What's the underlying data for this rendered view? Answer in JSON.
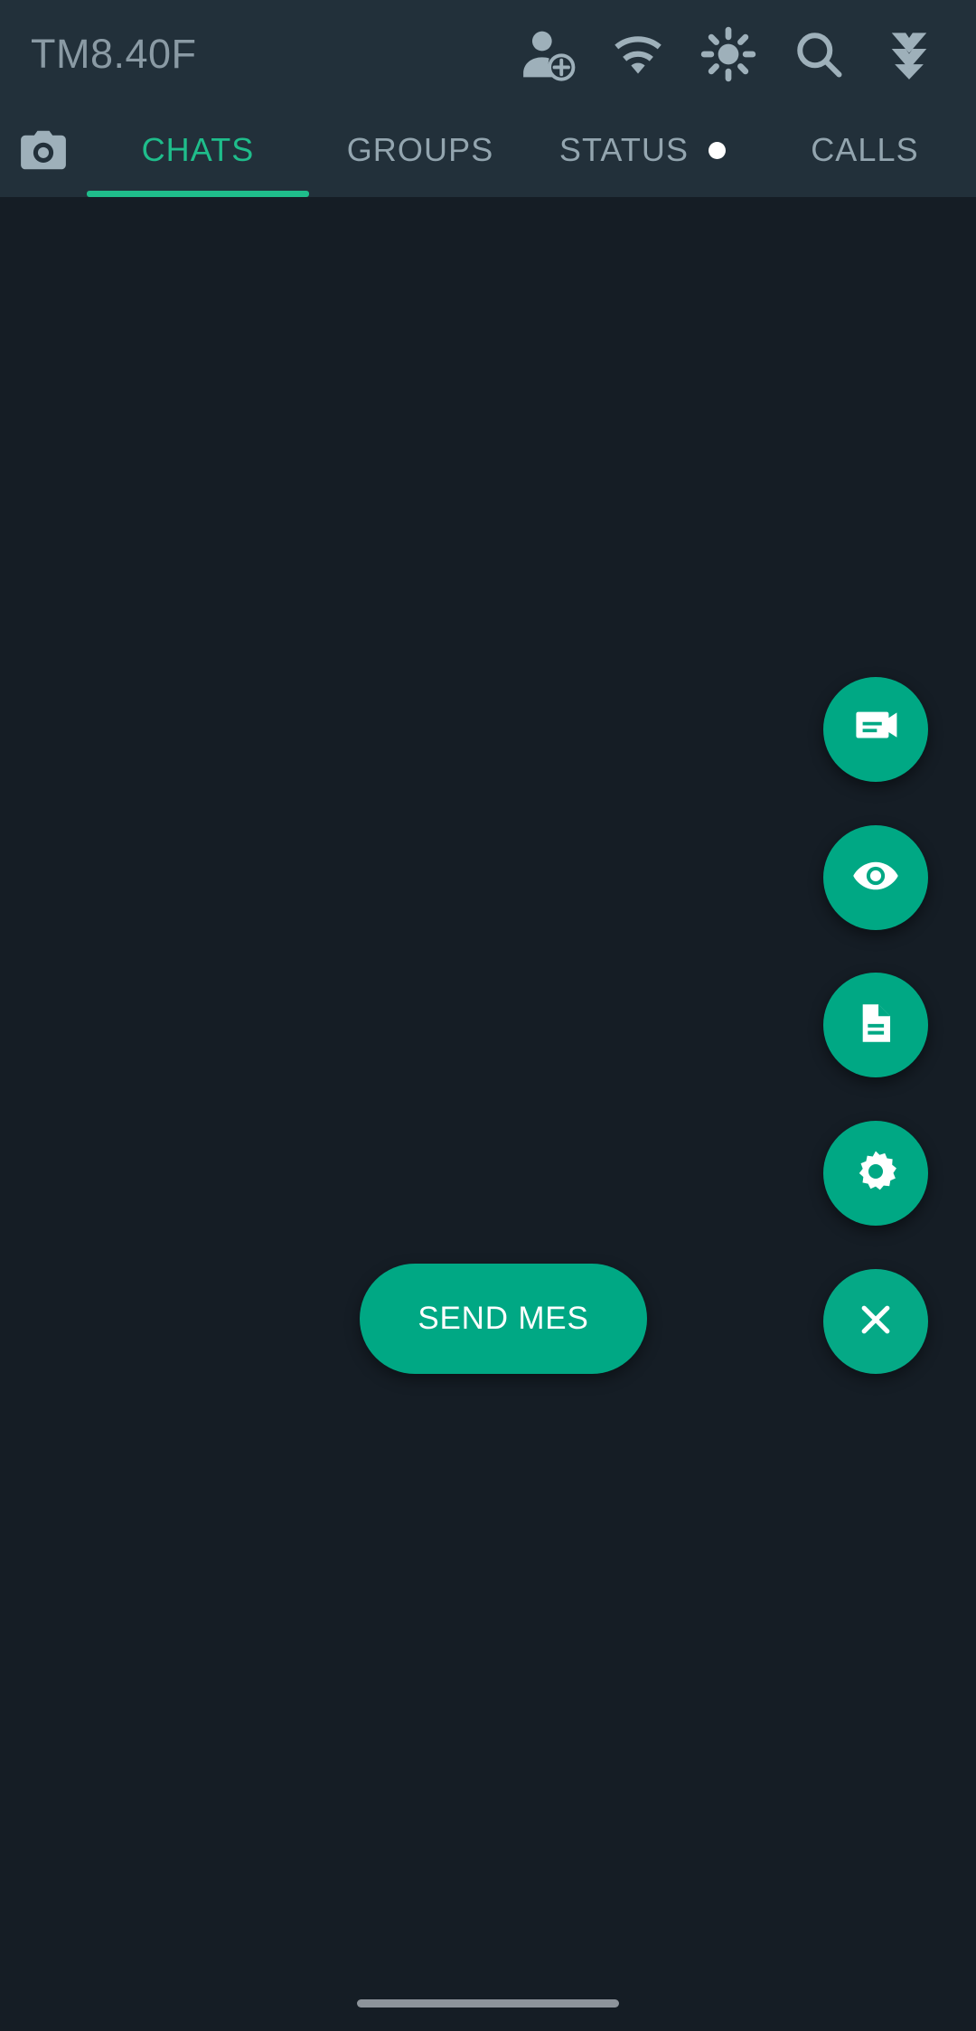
{
  "window": {
    "background": "#151d25",
    "accent": "#00a884",
    "topbar_background": "#22303a"
  },
  "topbar": {
    "title": "TM8.40F",
    "icons": [
      {
        "name": "add-person-icon",
        "label": "Add contact"
      },
      {
        "name": "wifi-icon",
        "label": "Wi-Fi"
      },
      {
        "name": "brightness-icon",
        "label": "Brightness"
      },
      {
        "name": "search-icon",
        "label": "Search"
      },
      {
        "name": "chevrons-down-icon",
        "label": "More"
      }
    ]
  },
  "tabs": {
    "camera_icon": "camera-icon",
    "items": [
      {
        "label": "CHATS",
        "active": true,
        "badge": false
      },
      {
        "label": "GROUPS",
        "active": false,
        "badge": false
      },
      {
        "label": "STATUS",
        "active": false,
        "badge": true
      },
      {
        "label": "CALLS",
        "active": false,
        "badge": false
      }
    ],
    "active_color": "#1fbd8b",
    "inactive_color": "#93a5af"
  },
  "fab_menu": {
    "color": "#00a884",
    "actions": [
      {
        "icon": "message-bubble-icon",
        "name": "new-message-fab"
      },
      {
        "icon": "eye-icon",
        "name": "view-status-fab"
      },
      {
        "icon": "document-icon",
        "name": "document-fab"
      },
      {
        "icon": "gear-icon",
        "name": "settings-fab"
      }
    ],
    "send_label": "SEND MES",
    "close_icon": "close-icon"
  },
  "navigation": {
    "gesture_bar": true
  }
}
